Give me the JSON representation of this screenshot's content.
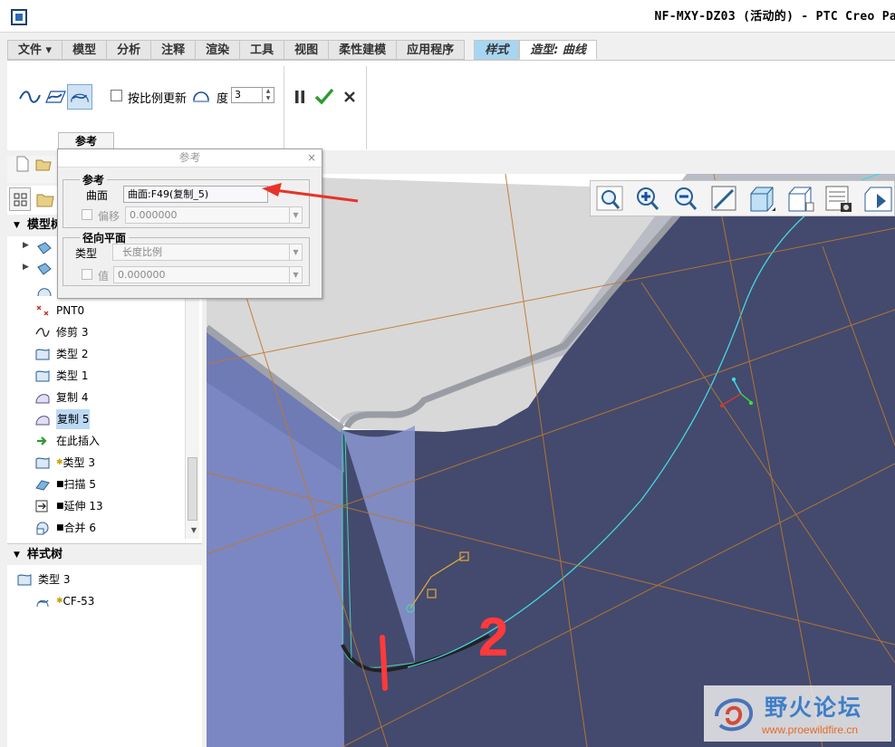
{
  "window": {
    "title": "NF-MXY-DZ03 (活动的) - PTC Creo Pa"
  },
  "tabs": [
    {
      "label": "文件 ▾"
    },
    {
      "label": "模型"
    },
    {
      "label": "分析"
    },
    {
      "label": "注释"
    },
    {
      "label": "渲染"
    },
    {
      "label": "工具"
    },
    {
      "label": "视图"
    },
    {
      "label": "柔性建模"
    },
    {
      "label": "应用程序"
    },
    {
      "label": "样式"
    },
    {
      "label": "造型: 曲线"
    }
  ],
  "ribbon": {
    "checkbox_label": "按比例更新",
    "degree_label": "度",
    "degree_value": "3",
    "ref_tab_label": "参考",
    "colors": {
      "accept": "#2e9a2e",
      "pause": "#333333"
    }
  },
  "dialog": {
    "title": "参考",
    "close": "×",
    "group1": {
      "title": "参考",
      "surface_label": "曲面",
      "surface_value": "曲面:F49(复制_5)",
      "offset_label": "偏移",
      "offset_value": "0.000000"
    },
    "group2": {
      "title": "径向平面",
      "type_label": "类型",
      "type_value": "长度比例",
      "value_label": "值",
      "value_value": "0.000000"
    }
  },
  "model_tree": {
    "header": "模型树",
    "items": [
      {
        "label": "PNT0",
        "icon": "point-icon"
      },
      {
        "label": "修剪 3",
        "icon": "curve-icon"
      },
      {
        "label": "类型 2",
        "icon": "surface-icon"
      },
      {
        "label": "类型 1",
        "icon": "surface-icon"
      },
      {
        "label": "复制 4",
        "icon": "copy-icon"
      },
      {
        "label": "复制 5",
        "icon": "copy-icon",
        "selected": true
      },
      {
        "label": "在此插入",
        "icon": "insert-arrow-icon"
      },
      {
        "label": "类型 3",
        "icon": "surface-icon"
      },
      {
        "label": "扫描 5",
        "icon": "sweep-icon"
      },
      {
        "label": "延伸 13",
        "icon": "extend-icon"
      },
      {
        "label": "合并 6",
        "icon": "merge-icon"
      }
    ]
  },
  "style_tree": {
    "header": "样式树",
    "items": [
      {
        "label": "类型 3"
      },
      {
        "label": "CF-53"
      }
    ]
  },
  "annotations": {
    "number": "2"
  },
  "watermark": {
    "name": "野火论坛",
    "url": "www.proewildfire.cn"
  }
}
